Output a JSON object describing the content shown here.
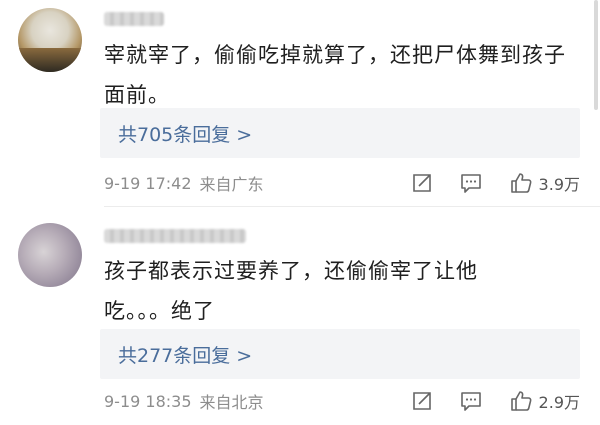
{
  "comments": [
    {
      "content": "宰就宰了，偷偷吃掉就算了，还把尸体舞到孩子面前。",
      "reply_label": "共705条回复 >",
      "time": "9-19 17:42",
      "source": "来自广东",
      "likes": "3.9万"
    },
    {
      "content": "孩子都表示过要养了，还偷偷宰了让他吃。。。绝了",
      "reply_label": "共277条回复 >",
      "time": "9-19 18:35",
      "source": "来自北京",
      "likes": "2.9万"
    }
  ],
  "icons": {
    "forward": "forward-icon",
    "comment": "comment-icon",
    "like": "thumbs-up-icon"
  },
  "colors": {
    "reply_link": "#4a6d9b",
    "reply_bg": "#f3f4f6",
    "meta_text": "#8d8d8d"
  }
}
